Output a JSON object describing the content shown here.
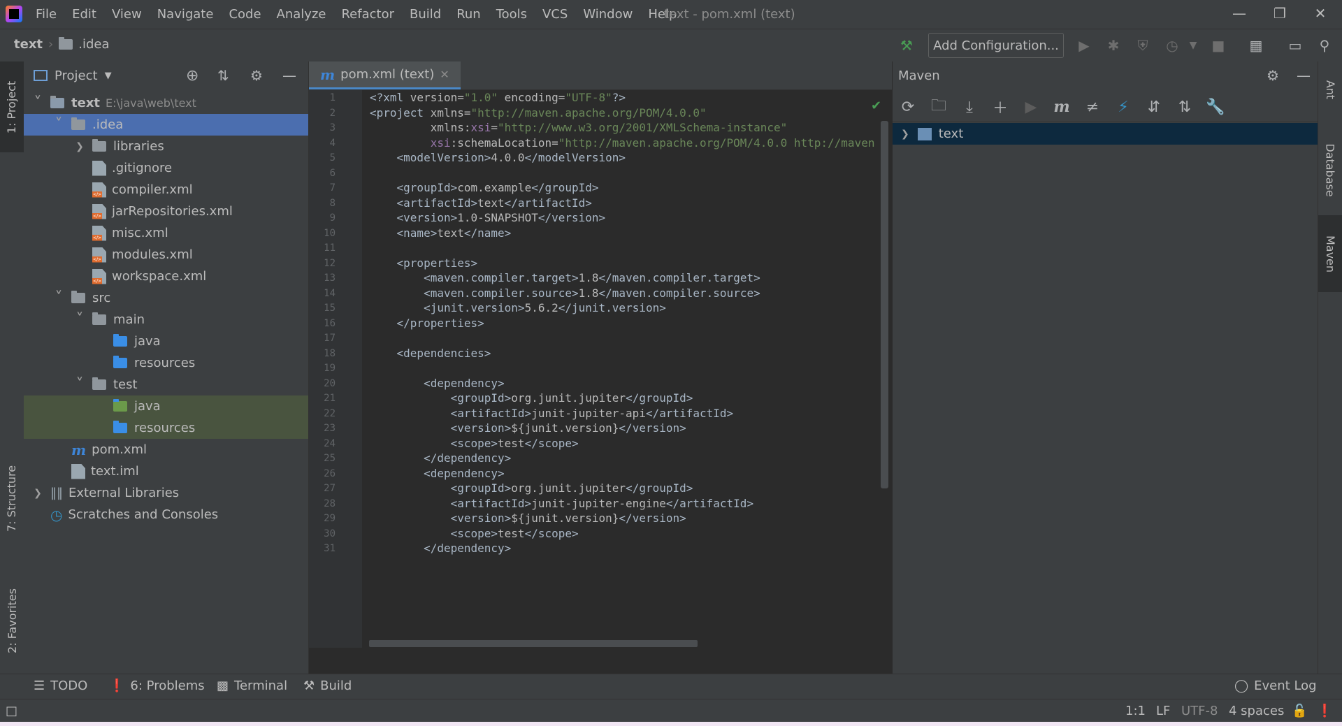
{
  "menu": [
    "File",
    "Edit",
    "View",
    "Navigate",
    "Code",
    "Analyze",
    "Refactor",
    "Build",
    "Run",
    "Tools",
    "VCS",
    "Window",
    "Help"
  ],
  "window_title": "text - pom.xml (text)",
  "breadcrumb": {
    "project": "text",
    "folder": ".idea"
  },
  "toolbar": {
    "add_configuration": "Add Configuration..."
  },
  "left_strip": {
    "project_tab": "1: Project",
    "structure_tab": "7: Structure",
    "favorites_tab": "2: Favorites"
  },
  "project_panel": {
    "title": "Project",
    "tree": [
      {
        "label": "text",
        "hint": "E:\\java\\web\\text",
        "depth": 0,
        "icon": "module-folder",
        "arrow": "down"
      },
      {
        "label": ".idea",
        "depth": 1,
        "icon": "folder",
        "arrow": "down",
        "state": "selected"
      },
      {
        "label": "libraries",
        "depth": 2,
        "icon": "folder",
        "arrow": "right"
      },
      {
        "label": ".gitignore",
        "depth": 2,
        "icon": "ignore-file"
      },
      {
        "label": "compiler.xml",
        "depth": 2,
        "icon": "xml-file"
      },
      {
        "label": "jarRepositories.xml",
        "depth": 2,
        "icon": "xml-file"
      },
      {
        "label": "misc.xml",
        "depth": 2,
        "icon": "xml-file"
      },
      {
        "label": "modules.xml",
        "depth": 2,
        "icon": "xml-file"
      },
      {
        "label": "workspace.xml",
        "depth": 2,
        "icon": "xml-file"
      },
      {
        "label": "src",
        "depth": 1,
        "icon": "folder",
        "arrow": "down"
      },
      {
        "label": "main",
        "depth": 2,
        "icon": "folder",
        "arrow": "down"
      },
      {
        "label": "java",
        "depth": 3,
        "icon": "source-folder"
      },
      {
        "label": "resources",
        "depth": 3,
        "icon": "resources-folder"
      },
      {
        "label": "test",
        "depth": 2,
        "icon": "folder",
        "arrow": "down"
      },
      {
        "label": "java",
        "depth": 3,
        "icon": "test-source-folder",
        "state": "test"
      },
      {
        "label": "resources",
        "depth": 3,
        "icon": "test-resources-folder",
        "state": "test"
      },
      {
        "label": "pom.xml",
        "depth": 1,
        "icon": "maven-file"
      },
      {
        "label": "text.iml",
        "depth": 1,
        "icon": "iml-file"
      },
      {
        "label": "External Libraries",
        "depth": 0,
        "icon": "libraries",
        "arrow": "right"
      },
      {
        "label": "Scratches and Consoles",
        "depth": 0,
        "icon": "scratches"
      }
    ]
  },
  "editor": {
    "tab_label": "pom.xml (text)",
    "lines": [
      [
        [
          "t",
          "<?xml "
        ],
        [
          "a",
          "version="
        ],
        [
          "v",
          "\"1.0\""
        ],
        [
          "a",
          " encoding="
        ],
        [
          "v",
          "\"UTF-8\""
        ],
        [
          "t",
          "?>"
        ]
      ],
      [
        [
          "t",
          "<project "
        ],
        [
          "a",
          "xmlns="
        ],
        [
          "v",
          "\"http://maven.apache.org/POM/4.0.0\""
        ]
      ],
      [
        [
          "a",
          "         xmlns:"
        ],
        [
          "ns",
          "xsi"
        ],
        [
          "a",
          "="
        ],
        [
          "v",
          "\"http://www.w3.org/2001/XMLSchema-instance\""
        ]
      ],
      [
        [
          "ns",
          "         xsi"
        ],
        [
          "a",
          ":schemaLocation="
        ],
        [
          "v",
          "\"http://maven.apache.org/POM/4.0.0 http://maven"
        ]
      ],
      [
        [
          "t",
          "    <modelVersion>"
        ],
        [
          "a",
          "4.0.0"
        ],
        [
          "t",
          "</modelVersion>"
        ]
      ],
      [],
      [
        [
          "t",
          "    <groupId>"
        ],
        [
          "a",
          "com.example"
        ],
        [
          "t",
          "</groupId>"
        ]
      ],
      [
        [
          "t",
          "    <artifactId>"
        ],
        [
          "a",
          "text"
        ],
        [
          "t",
          "</artifactId>"
        ]
      ],
      [
        [
          "t",
          "    <version>"
        ],
        [
          "a",
          "1.0-SNAPSHOT"
        ],
        [
          "t",
          "</version>"
        ]
      ],
      [
        [
          "t",
          "    <name>"
        ],
        [
          "a",
          "text"
        ],
        [
          "t",
          "</name>"
        ]
      ],
      [],
      [
        [
          "t",
          "    <properties>"
        ]
      ],
      [
        [
          "t",
          "        <maven.compiler.target>"
        ],
        [
          "a",
          "1.8"
        ],
        [
          "t",
          "</maven.compiler.target>"
        ]
      ],
      [
        [
          "t",
          "        <maven.compiler.source>"
        ],
        [
          "a",
          "1.8"
        ],
        [
          "t",
          "</maven.compiler.source>"
        ]
      ],
      [
        [
          "t",
          "        <junit.version>"
        ],
        [
          "a",
          "5.6.2"
        ],
        [
          "t",
          "</junit.version>"
        ]
      ],
      [
        [
          "t",
          "    </properties>"
        ]
      ],
      [],
      [
        [
          "t",
          "    <dependencies>"
        ]
      ],
      [],
      [
        [
          "t",
          "        <dependency>"
        ]
      ],
      [
        [
          "t",
          "            <groupId>"
        ],
        [
          "a",
          "org.junit.jupiter"
        ],
        [
          "t",
          "</groupId>"
        ]
      ],
      [
        [
          "t",
          "            <artifactId>"
        ],
        [
          "a",
          "junit-jupiter-api"
        ],
        [
          "t",
          "</artifactId>"
        ]
      ],
      [
        [
          "t",
          "            <version>"
        ],
        [
          "a",
          "${junit.version}"
        ],
        [
          "t",
          "</version>"
        ]
      ],
      [
        [
          "t",
          "            <scope>"
        ],
        [
          "a",
          "test"
        ],
        [
          "t",
          "</scope>"
        ]
      ],
      [
        [
          "t",
          "        </dependency>"
        ]
      ],
      [
        [
          "t",
          "        <dependency>"
        ]
      ],
      [
        [
          "t",
          "            <groupId>"
        ],
        [
          "a",
          "org.junit.jupiter"
        ],
        [
          "t",
          "</groupId>"
        ]
      ],
      [
        [
          "t",
          "            <artifactId>"
        ],
        [
          "a",
          "junit-jupiter-engine"
        ],
        [
          "t",
          "</artifactId>"
        ]
      ],
      [
        [
          "t",
          "            <version>"
        ],
        [
          "a",
          "${junit.version}"
        ],
        [
          "t",
          "</version>"
        ]
      ],
      [
        [
          "t",
          "            <scope>"
        ],
        [
          "a",
          "test"
        ],
        [
          "t",
          "</scope>"
        ]
      ],
      [
        [
          "t",
          "        </dependency>"
        ]
      ]
    ]
  },
  "maven": {
    "title": "Maven",
    "project": "text"
  },
  "right_strip": {
    "ant": "Ant",
    "database": "Database",
    "maven": "Maven"
  },
  "bottom_tools": {
    "todo": "TODO",
    "problems": "6: Problems",
    "terminal": "Terminal",
    "build": "Build",
    "event_log": "Event Log"
  },
  "status": {
    "position": "1:1",
    "line_sep": "LF",
    "encoding": "UTF-8",
    "indent": "4 spaces"
  }
}
